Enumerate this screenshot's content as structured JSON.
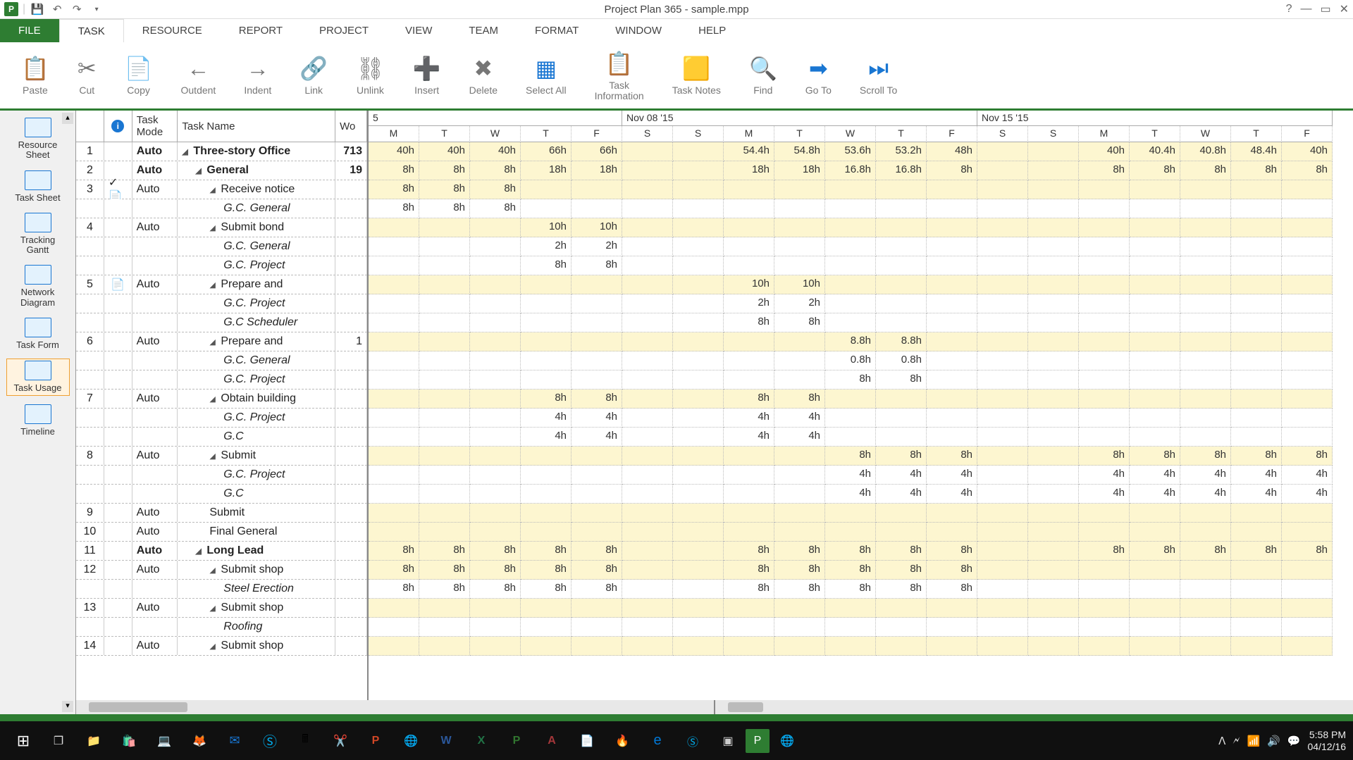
{
  "title": "Project Plan 365 - sample.mpp",
  "menus": [
    "FILE",
    "TASK",
    "RESOURCE",
    "REPORT",
    "PROJECT",
    "VIEW",
    "TEAM",
    "FORMAT",
    "WINDOW",
    "HELP"
  ],
  "ribbon": [
    {
      "id": "paste",
      "label": "Paste"
    },
    {
      "id": "cut",
      "label": "Cut"
    },
    {
      "id": "copy",
      "label": "Copy"
    },
    {
      "id": "outdent",
      "label": "Outdent"
    },
    {
      "id": "indent",
      "label": "Indent"
    },
    {
      "id": "link",
      "label": "Link"
    },
    {
      "id": "unlink",
      "label": "Unlink"
    },
    {
      "id": "insert",
      "label": "Insert"
    },
    {
      "id": "delete",
      "label": "Delete"
    },
    {
      "id": "selectall",
      "label": "Select All"
    },
    {
      "id": "taskinfo",
      "label": "Task\nInformation"
    },
    {
      "id": "tasknotes",
      "label": "Task Notes"
    },
    {
      "id": "find",
      "label": "Find"
    },
    {
      "id": "goto",
      "label": "Go To"
    },
    {
      "id": "scrollto",
      "label": "Scroll To"
    }
  ],
  "leftnav": [
    {
      "id": "resource-sheet",
      "label": "Resource\nSheet"
    },
    {
      "id": "task-sheet",
      "label": "Task Sheet"
    },
    {
      "id": "tracking-gantt",
      "label": "Tracking\nGantt"
    },
    {
      "id": "network-diagram",
      "label": "Network\nDiagram"
    },
    {
      "id": "task-form",
      "label": "Task Form"
    },
    {
      "id": "task-usage",
      "label": "Task Usage",
      "active": true
    },
    {
      "id": "timeline",
      "label": "Timeline"
    }
  ],
  "columns": {
    "info": "ⓘ",
    "mode": "Task\nMode",
    "name": "Task Name",
    "work": "Wo"
  },
  "rows": [
    {
      "id": "1",
      "mode": "Auto",
      "name": "Three-story Office",
      "work": "713",
      "b": true,
      "ind": 0,
      "c": true
    },
    {
      "id": "2",
      "mode": "Auto",
      "name": "General",
      "work": "19",
      "b": true,
      "ind": 1,
      "c": true
    },
    {
      "id": "3",
      "mode": "Auto",
      "name": "Receive notice",
      "ind": 2,
      "c": true,
      "info": "✓📄"
    },
    {
      "id": "",
      "mode": "",
      "name": "G.C. General",
      "ind": 3,
      "it": true
    },
    {
      "id": "4",
      "mode": "Auto",
      "name": "Submit bond",
      "ind": 2,
      "c": true
    },
    {
      "id": "",
      "mode": "",
      "name": "G.C. General",
      "ind": 3,
      "it": true
    },
    {
      "id": "",
      "mode": "",
      "name": "G.C. Project",
      "ind": 3,
      "it": true
    },
    {
      "id": "5",
      "mode": "Auto",
      "name": "Prepare and",
      "ind": 2,
      "c": true,
      "info": "📄"
    },
    {
      "id": "",
      "mode": "",
      "name": "G.C. Project",
      "ind": 3,
      "it": true
    },
    {
      "id": "",
      "mode": "",
      "name": "G.C Scheduler",
      "ind": 3,
      "it": true
    },
    {
      "id": "6",
      "mode": "Auto",
      "name": "Prepare and",
      "work": "1",
      "ind": 2,
      "c": true
    },
    {
      "id": "",
      "mode": "",
      "name": "G.C. General",
      "ind": 3,
      "it": true
    },
    {
      "id": "",
      "mode": "",
      "name": "G.C. Project",
      "ind": 3,
      "it": true
    },
    {
      "id": "7",
      "mode": "Auto",
      "name": "Obtain building",
      "ind": 2,
      "c": true
    },
    {
      "id": "",
      "mode": "",
      "name": "G.C. Project",
      "ind": 3,
      "it": true
    },
    {
      "id": "",
      "mode": "",
      "name": "G.C",
      "ind": 3,
      "it": true
    },
    {
      "id": "8",
      "mode": "Auto",
      "name": "Submit",
      "ind": 2,
      "c": true
    },
    {
      "id": "",
      "mode": "",
      "name": "G.C. Project",
      "ind": 3,
      "it": true
    },
    {
      "id": "",
      "mode": "",
      "name": "G.C",
      "ind": 3,
      "it": true
    },
    {
      "id": "9",
      "mode": "Auto",
      "name": "Submit",
      "ind": 2
    },
    {
      "id": "10",
      "mode": "Auto",
      "name": "Final General",
      "ind": 2
    },
    {
      "id": "11",
      "mode": "Auto",
      "name": "Long Lead",
      "b": true,
      "ind": 1,
      "c": true
    },
    {
      "id": "12",
      "mode": "Auto",
      "name": "Submit shop",
      "ind": 2,
      "c": true
    },
    {
      "id": "",
      "mode": "",
      "name": "Steel Erection",
      "ind": 3,
      "it": true
    },
    {
      "id": "13",
      "mode": "Auto",
      "name": "Submit shop",
      "ind": 2,
      "c": true
    },
    {
      "id": "",
      "mode": "",
      "name": "Roofing",
      "ind": 3,
      "it": true
    },
    {
      "id": "14",
      "mode": "Auto",
      "name": "Submit shop",
      "ind": 2,
      "c": true
    }
  ],
  "weeks": [
    {
      "label": "5",
      "span": 5
    },
    {
      "label": "Nov 08 '15",
      "span": 7
    },
    {
      "label": "Nov 15 '15",
      "span": 7
    }
  ],
  "days": [
    "M",
    "T",
    "W",
    "T",
    "F",
    "S",
    "S",
    "M",
    "T",
    "W",
    "T",
    "F",
    "S",
    "S",
    "M",
    "T",
    "W",
    "T",
    "F"
  ],
  "timedata": [
    {
      "y": true,
      "v": [
        "40h",
        "40h",
        "40h",
        "66h",
        "66h",
        "",
        "",
        "54.4h",
        "54.8h",
        "53.6h",
        "53.2h",
        "48h",
        "",
        "",
        "40h",
        "40.4h",
        "40.8h",
        "48.4h",
        "40h"
      ]
    },
    {
      "y": true,
      "v": [
        "8h",
        "8h",
        "8h",
        "18h",
        "18h",
        "",
        "",
        "18h",
        "18h",
        "16.8h",
        "16.8h",
        "8h",
        "",
        "",
        "8h",
        "8h",
        "8h",
        "8h",
        "8h"
      ]
    },
    {
      "y": true,
      "v": [
        "8h",
        "8h",
        "8h",
        "",
        "",
        "",
        "",
        "",
        "",
        "",
        "",
        "",
        "",
        "",
        "",
        "",
        "",
        "",
        ""
      ]
    },
    {
      "v": [
        "8h",
        "8h",
        "8h",
        "",
        "",
        "",
        "",
        "",
        "",
        "",
        "",
        "",
        "",
        "",
        "",
        "",
        "",
        "",
        ""
      ]
    },
    {
      "y": true,
      "v": [
        "",
        "",
        "",
        "10h",
        "10h",
        "",
        "",
        "",
        "",
        "",
        "",
        "",
        "",
        "",
        "",
        "",
        "",
        "",
        ""
      ]
    },
    {
      "v": [
        "",
        "",
        "",
        "2h",
        "2h",
        "",
        "",
        "",
        "",
        "",
        "",
        "",
        "",
        "",
        "",
        "",
        "",
        "",
        ""
      ]
    },
    {
      "v": [
        "",
        "",
        "",
        "8h",
        "8h",
        "",
        "",
        "",
        "",
        "",
        "",
        "",
        "",
        "",
        "",
        "",
        "",
        "",
        ""
      ]
    },
    {
      "y": true,
      "v": [
        "",
        "",
        "",
        "",
        "",
        "",
        "",
        "10h",
        "10h",
        "",
        "",
        "",
        "",
        "",
        "",
        "",
        "",
        "",
        ""
      ]
    },
    {
      "v": [
        "",
        "",
        "",
        "",
        "",
        "",
        "",
        "2h",
        "2h",
        "",
        "",
        "",
        "",
        "",
        "",
        "",
        "",
        "",
        ""
      ]
    },
    {
      "v": [
        "",
        "",
        "",
        "",
        "",
        "",
        "",
        "8h",
        "8h",
        "",
        "",
        "",
        "",
        "",
        "",
        "",
        "",
        "",
        ""
      ]
    },
    {
      "y": true,
      "v": [
        "",
        "",
        "",
        "",
        "",
        "",
        "",
        "",
        "",
        "8.8h",
        "8.8h",
        "",
        "",
        "",
        "",
        "",
        "",
        "",
        ""
      ]
    },
    {
      "v": [
        "",
        "",
        "",
        "",
        "",
        "",
        "",
        "",
        "",
        "0.8h",
        "0.8h",
        "",
        "",
        "",
        "",
        "",
        "",
        "",
        ""
      ]
    },
    {
      "v": [
        "",
        "",
        "",
        "",
        "",
        "",
        "",
        "",
        "",
        "8h",
        "8h",
        "",
        "",
        "",
        "",
        "",
        "",
        "",
        ""
      ]
    },
    {
      "y": true,
      "v": [
        "",
        "",
        "",
        "8h",
        "8h",
        "",
        "",
        "8h",
        "8h",
        "",
        "",
        "",
        "",
        "",
        "",
        "",
        "",
        "",
        ""
      ]
    },
    {
      "v": [
        "",
        "",
        "",
        "4h",
        "4h",
        "",
        "",
        "4h",
        "4h",
        "",
        "",
        "",
        "",
        "",
        "",
        "",
        "",
        "",
        ""
      ]
    },
    {
      "v": [
        "",
        "",
        "",
        "4h",
        "4h",
        "",
        "",
        "4h",
        "4h",
        "",
        "",
        "",
        "",
        "",
        "",
        "",
        "",
        "",
        ""
      ]
    },
    {
      "y": true,
      "v": [
        "",
        "",
        "",
        "",
        "",
        "",
        "",
        "",
        "",
        "8h",
        "8h",
        "8h",
        "",
        "",
        "8h",
        "8h",
        "8h",
        "8h",
        "8h"
      ]
    },
    {
      "v": [
        "",
        "",
        "",
        "",
        "",
        "",
        "",
        "",
        "",
        "4h",
        "4h",
        "4h",
        "",
        "",
        "4h",
        "4h",
        "4h",
        "4h",
        "4h"
      ]
    },
    {
      "v": [
        "",
        "",
        "",
        "",
        "",
        "",
        "",
        "",
        "",
        "4h",
        "4h",
        "4h",
        "",
        "",
        "4h",
        "4h",
        "4h",
        "4h",
        "4h"
      ]
    },
    {
      "y": true,
      "v": [
        "",
        "",
        "",
        "",
        "",
        "",
        "",
        "",
        "",
        "",
        "",
        "",
        "",
        "",
        "",
        "",
        "",
        "",
        ""
      ]
    },
    {
      "y": true,
      "v": [
        "",
        "",
        "",
        "",
        "",
        "",
        "",
        "",
        "",
        "",
        "",
        "",
        "",
        "",
        "",
        "",
        "",
        "",
        ""
      ]
    },
    {
      "y": true,
      "v": [
        "8h",
        "8h",
        "8h",
        "8h",
        "8h",
        "",
        "",
        "8h",
        "8h",
        "8h",
        "8h",
        "8h",
        "",
        "",
        "8h",
        "8h",
        "8h",
        "8h",
        "8h"
      ]
    },
    {
      "y": true,
      "v": [
        "8h",
        "8h",
        "8h",
        "8h",
        "8h",
        "",
        "",
        "8h",
        "8h",
        "8h",
        "8h",
        "8h",
        "",
        "",
        "",
        "",
        "",
        "",
        ""
      ]
    },
    {
      "v": [
        "8h",
        "8h",
        "8h",
        "8h",
        "8h",
        "",
        "",
        "8h",
        "8h",
        "8h",
        "8h",
        "8h",
        "",
        "",
        "",
        "",
        "",
        "",
        ""
      ]
    },
    {
      "y": true,
      "v": [
        "",
        "",
        "",
        "",
        "",
        "",
        "",
        "",
        "",
        "",
        "",
        "",
        "",
        "",
        "",
        "",
        "",
        "",
        ""
      ]
    },
    {
      "v": [
        "",
        "",
        "",
        "",
        "",
        "",
        "",
        "",
        "",
        "",
        "",
        "",
        "",
        "",
        "",
        "",
        "",
        "",
        ""
      ]
    },
    {
      "y": true,
      "v": [
        "",
        "",
        "",
        "",
        "",
        "",
        "",
        "",
        "",
        "",
        "",
        "",
        "",
        "",
        "",
        "",
        "",
        "",
        ""
      ]
    }
  ],
  "clock": {
    "time": "5:58 PM",
    "date": "04/12/16"
  }
}
